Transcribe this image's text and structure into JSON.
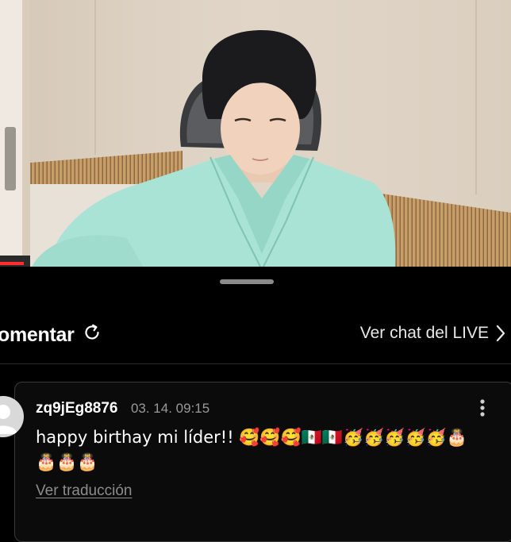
{
  "video": {
    "scene": "live-stream-frame"
  },
  "sheet": {
    "comment_title": "omentar",
    "refresh_icon": "refresh-icon",
    "live_link_label": "Ver chat del LIVE",
    "live_link_icon": "chevron-right-icon"
  },
  "comment": {
    "username": "zq9jEg8876",
    "timestamp": "03. 14. 09:15",
    "text": "happy birthay mi líder!! 🥰🥰🥰🇲🇽🇲🇽🥳🥳🥳🥳🥳🎂🎂🎂🎂",
    "translate_label": "Ver traducción",
    "more_icon": "more-vertical-icon"
  },
  "colors": {
    "background": "#000000",
    "progress": "#ff2d2d",
    "shirt": "#a9e3d6",
    "wall": "#ddd2c3",
    "wood_panel": "#c99d68"
  }
}
